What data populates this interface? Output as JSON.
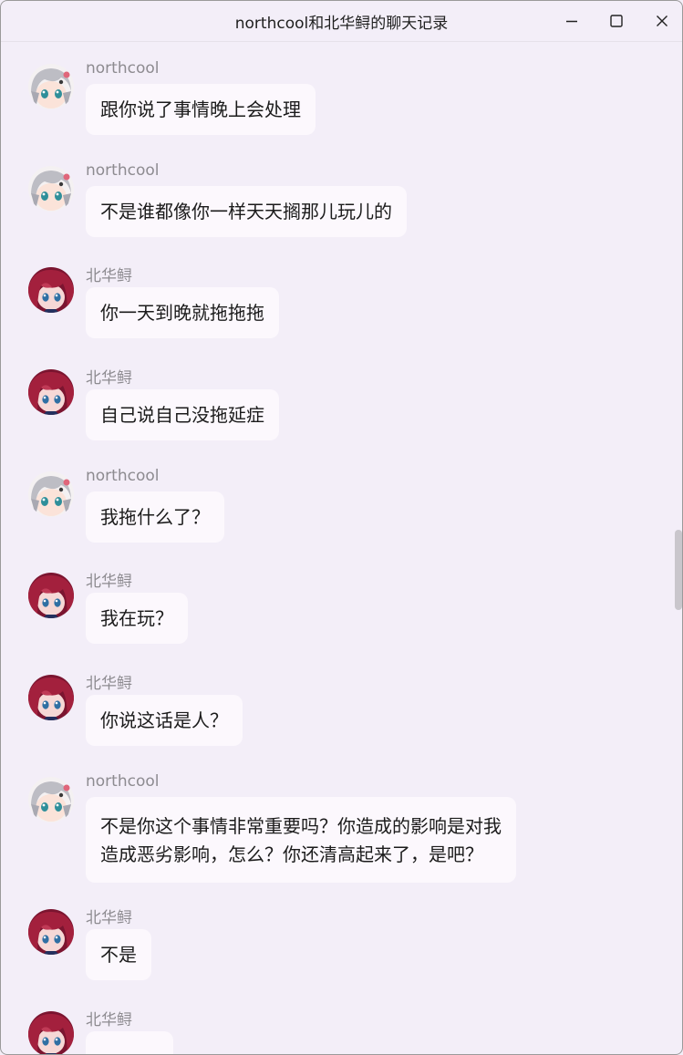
{
  "window": {
    "title": "northcool和北华鲟的聊天记录",
    "controls": [
      "minimize-icon",
      "maximize-icon",
      "close-icon"
    ]
  },
  "users": {
    "northcool": {
      "name": "northcool",
      "avatar": "anime-avatar-silver-hair"
    },
    "beihuaxun": {
      "name": "北华鲟",
      "avatar": "anime-avatar-red-hair"
    }
  },
  "messages": [
    {
      "sender": "northcool",
      "text": "跟你说了事情晚上会处理"
    },
    {
      "sender": "northcool",
      "text": "不是谁都像你一样天天搁那儿玩儿的"
    },
    {
      "sender": "北华鲟",
      "text": "你一天到晚就拖拖拖"
    },
    {
      "sender": "北华鲟",
      "text": "自己说自己没拖延症"
    },
    {
      "sender": "northcool",
      "text": "我拖什么了？"
    },
    {
      "sender": "北华鲟",
      "text": "我在玩？"
    },
    {
      "sender": "北华鲟",
      "text": "你说这话是人？"
    },
    {
      "sender": "northcool",
      "lines": [
        "不是你这个事情非常重要吗？你造成的影响是对我",
        "造成恶劣影响，怎么？你还清高起来了，是吧？"
      ]
    },
    {
      "sender": "北华鲟",
      "text": "不是"
    },
    {
      "sender": "北华鲟",
      "text": ""
    }
  ],
  "colors": {
    "background": "#f3eef8",
    "bubble": "#fcf8fd",
    "sender_name": "#8d8b90",
    "text": "#1b1b1b"
  }
}
